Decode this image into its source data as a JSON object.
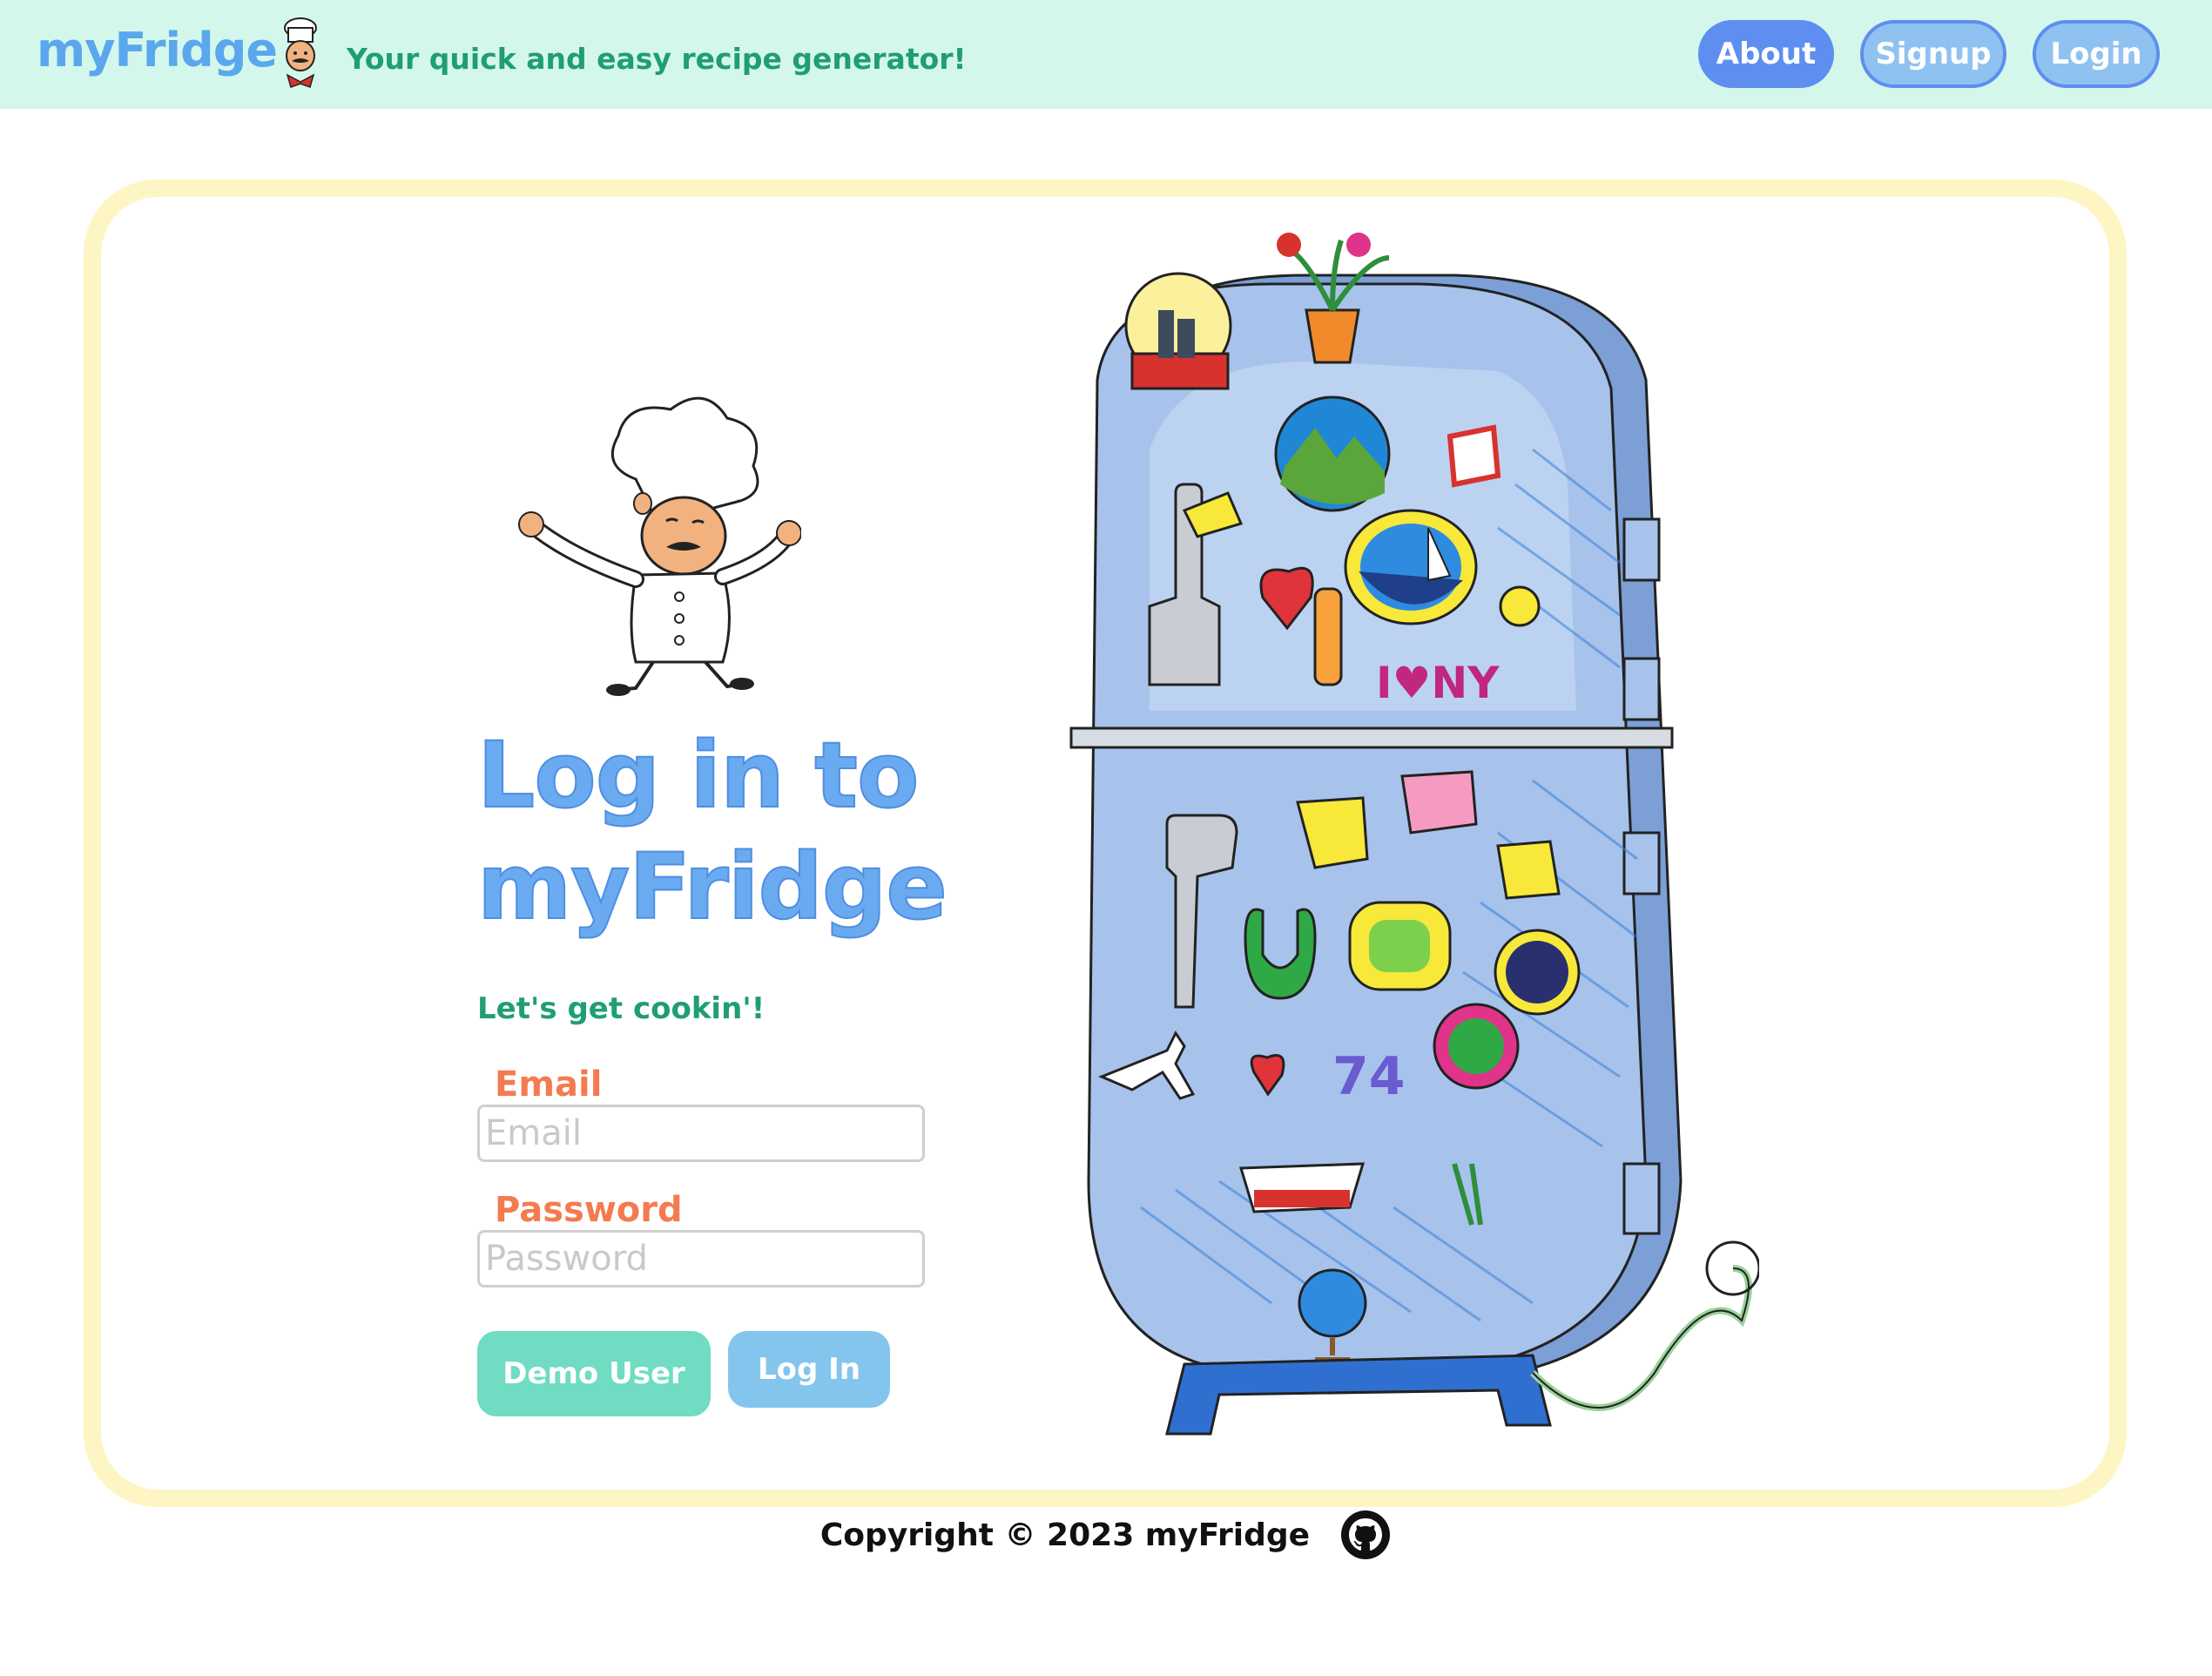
{
  "header": {
    "brand": "myFridge",
    "tagline": "Your quick and easy recipe generator!",
    "nav": {
      "about": "About",
      "signup": "Signup",
      "login": "Login"
    }
  },
  "login": {
    "title": "Log in to myFridge",
    "subtitle": "Let's get cookin'!",
    "email_label": "Email",
    "email_placeholder": "Email",
    "email_value": "",
    "password_label": "Password",
    "password_placeholder": "Password",
    "password_value": "",
    "demo_button": "Demo User",
    "login_button": "Log In"
  },
  "footer": {
    "copyright": "Copyright © 2023 myFridge"
  },
  "colors": {
    "header_bg": "#d4f7ec",
    "brand": "#5aa7ee",
    "tagline": "#1f9e73",
    "accent_button": "#5e8ef0",
    "label": "#f47b4f",
    "demo_button": "#6fdcc3",
    "login_button": "#84c5ee",
    "card_glow": "#fdf6c4"
  },
  "icons": [
    "chef-logo-icon",
    "chef-illustration",
    "fridge-illustration",
    "github-icon"
  ]
}
